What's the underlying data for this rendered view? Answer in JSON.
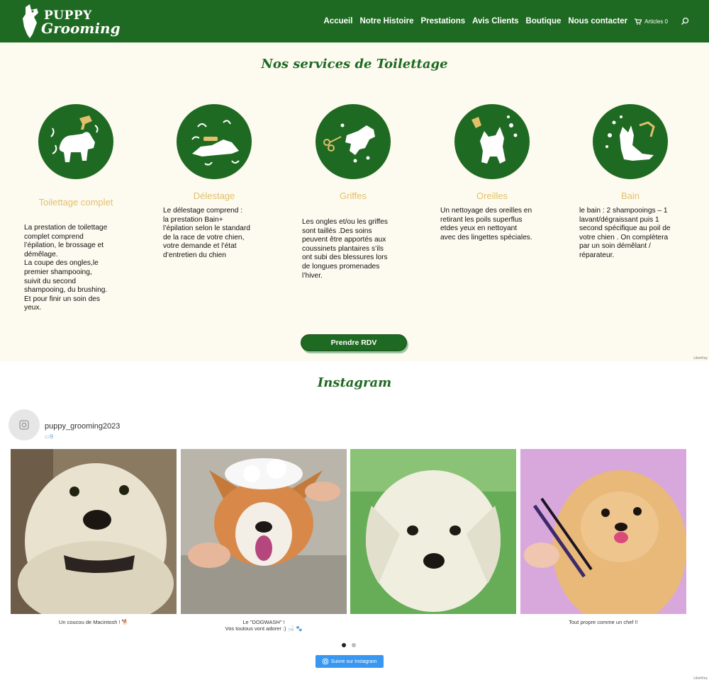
{
  "brand": {
    "line1": "PUPPY",
    "line2": "Grooming"
  },
  "nav": {
    "items": [
      {
        "label": "Accueil"
      },
      {
        "label": "Notre Histoire"
      },
      {
        "label": "Prestations"
      },
      {
        "label": "Avis Clients"
      },
      {
        "label": "Boutique"
      },
      {
        "label": "Nous contacter"
      }
    ],
    "cart_label": "Articles 0"
  },
  "services": {
    "title": "Nos services de Toilettage",
    "items": [
      {
        "title": "Toilettage complet",
        "icon": "dog-dryer-icon",
        "text": "La prestation de toilettage\ncomplet comprend\nl’épilation, le brossage et\ndémêlage.\nLa coupe des ongles,le\npremier shampooing,\nsuivit du second\nshampooing, du brushing.\nEt pour finir un soin des\nyeux."
      },
      {
        "title": "Délestage",
        "icon": "dog-brush-icon",
        "text": "Le délestage comprend :\nla prestation Bain+\nl’épilation selon le standard\nde la race de votre chien,\nvotre demande et l’état\nd’entretien du chien"
      },
      {
        "title": "Griffes",
        "icon": "dog-scissors-icon",
        "text": "Les ongles et/ou les griffes\nsont taillés .Des soins\npeuvent être apportés aux\ncoussinets plantaires s’ils\nont subi des blessures lors\nde longues promenades\nl’hiver."
      },
      {
        "title": "Oreilles",
        "icon": "dog-ear-cleaner-icon",
        "text": "Un nettoyage des oreilles en\nretirant les poils superflus\netdes yeux en nettoyant\navec des lingettes spéciales."
      },
      {
        "title": "Bain",
        "icon": "dog-shower-icon",
        "text": "le bain : 2 shampooings – 1\nlavant/dégraissant puis 1\nsecond spécifique au poil de\nvotre chien . On complètera\npar un soin démêlant /\nréparateur."
      }
    ],
    "button_label": "Prendre RDV"
  },
  "instagram": {
    "title": "Instagram",
    "username": "puppy_grooming2023",
    "post_count": "9",
    "posts": [
      {
        "caption": "Un coucou de Macintosh ! 🐕",
        "image": "westie-closeup"
      },
      {
        "caption": "Le \"DOGWASH\" !\nVos toutous vont adorer :) 🛁 🐾",
        "image": "corgi-shampoo"
      },
      {
        "caption": "",
        "image": "white-puppy"
      },
      {
        "caption": "Tout propre comme un chef !!",
        "image": "pomeranian-scissors"
      }
    ],
    "follow_label": "Suivre sur Instagram",
    "carousel_active": 1,
    "carousel_total": 2
  },
  "footer_note": "LiberKey",
  "colors": {
    "brand_green": "#1f6a22",
    "service_title": "#e2c06a",
    "cream": "#fdfaf0",
    "instagram_blue": "#3897f0"
  }
}
